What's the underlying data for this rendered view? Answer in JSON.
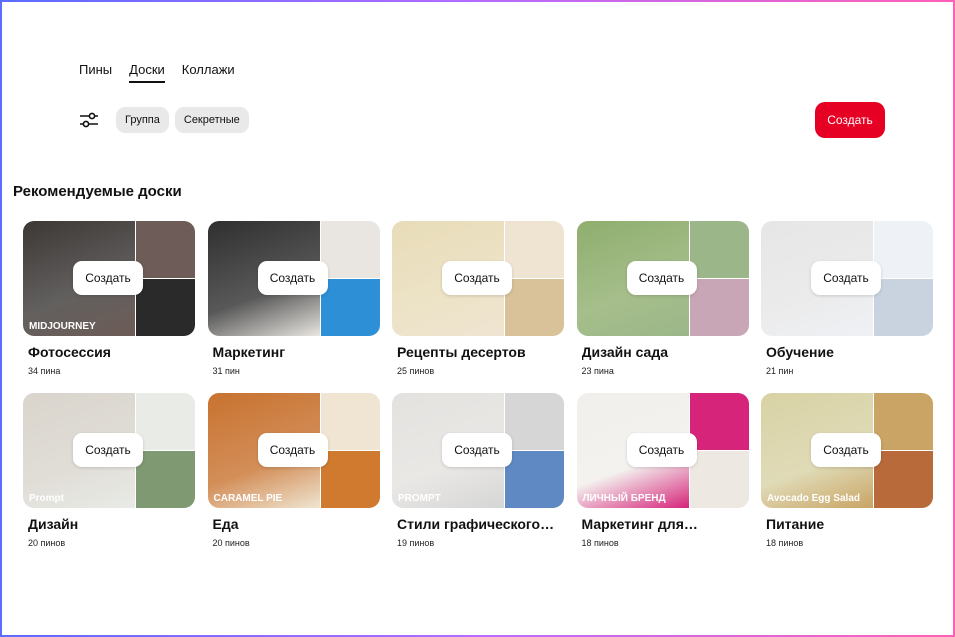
{
  "tabs": [
    {
      "label": "Пины",
      "active": false
    },
    {
      "label": "Доски",
      "active": true
    },
    {
      "label": "Коллажи",
      "active": false
    }
  ],
  "filters": {
    "icon": "sliders-icon",
    "chips": [
      "Группа",
      "Секретные"
    ]
  },
  "create_button": "Создать",
  "section_title": "Рекомендуемые доски",
  "card_create_label": "Создать",
  "boards": [
    {
      "title": "Фотосессия",
      "count": "34 пина",
      "cover_text": "MIDJOURNEY",
      "colors": [
        "#3b3836",
        "#6d5c57",
        "#2a2a2a"
      ]
    },
    {
      "title": "Маркетинг",
      "count": "31 пин",
      "cover_text": "",
      "colors": [
        "#2f2f2f",
        "#e9e6e1",
        "#2d8fd6"
      ]
    },
    {
      "title": "Рецепты десертов",
      "count": "25 пинов",
      "cover_text": "",
      "colors": [
        "#e8dcb8",
        "#efe4d2",
        "#d9c29a"
      ]
    },
    {
      "title": "Дизайн сада",
      "count": "23 пина",
      "cover_text": "",
      "colors": [
        "#8fae6e",
        "#9bb689",
        "#c9a6b6"
      ]
    },
    {
      "title": "Обучение",
      "count": "21 пин",
      "cover_text": "",
      "colors": [
        "#e6e6e6",
        "#eef1f5",
        "#c9d3df"
      ]
    },
    {
      "title": "Дизайн",
      "count": "20 пинов",
      "cover_text": "Prompt",
      "colors": [
        "#d9d5cd",
        "#e8ebe6",
        "#7f9a72"
      ]
    },
    {
      "title": "Еда",
      "count": "20 пинов",
      "cover_text": "CARAMEL PIE",
      "colors": [
        "#c8722f",
        "#efe5d2",
        "#cf7a2e"
      ]
    },
    {
      "title": "Стили графического…",
      "count": "19 пинов",
      "cover_text": "PROMPT",
      "colors": [
        "#e4e2df",
        "#d6d6d6",
        "#5f89c2"
      ]
    },
    {
      "title": "Маркетинг для…",
      "count": "18 пинов",
      "cover_text": "ЛИЧНЫЙ БРЕНД",
      "colors": [
        "#f1efeb",
        "#d6247a",
        "#ede8e2"
      ]
    },
    {
      "title": "Питание",
      "count": "18 пинов",
      "cover_text": "Avocado Egg Salad",
      "colors": [
        "#d8d2a5",
        "#c9a464",
        "#b86a3a"
      ]
    }
  ]
}
